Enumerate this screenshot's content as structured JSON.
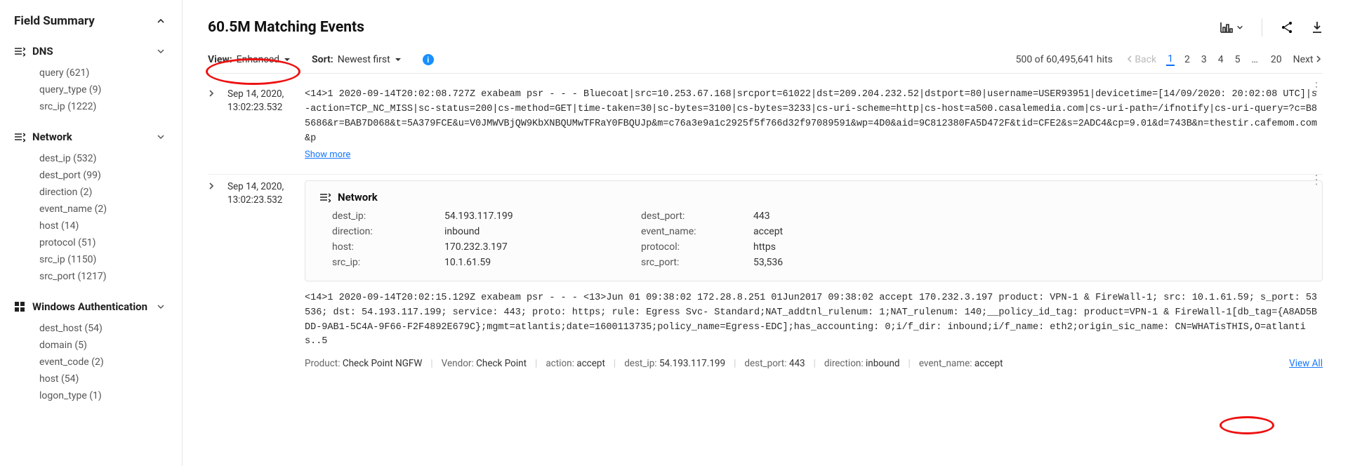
{
  "sidebar": {
    "title": "Field Summary",
    "groups": [
      {
        "icon": "dns",
        "label": "DNS",
        "items": [
          "query (621)",
          "query_type (9)",
          "src_ip (1222)"
        ]
      },
      {
        "icon": "network",
        "label": "Network",
        "items": [
          "dest_ip (532)",
          "dest_port (99)",
          "direction (2)",
          "event_name (2)",
          "host (14)",
          "protocol (51)",
          "src_ip (1150)",
          "src_port (1217)"
        ]
      },
      {
        "icon": "windows",
        "label": "Windows Authentication",
        "items": [
          "dest_host (54)",
          "domain (5)",
          "event_code (2)",
          "host (54)",
          "logon_type (1)"
        ]
      }
    ]
  },
  "header": {
    "title": "60.5M Matching Events"
  },
  "controls": {
    "view_label": "View:",
    "view_value": "Enhanced",
    "sort_label": "Sort:",
    "sort_value": "Newest first",
    "hits_text": "500 of 60,495,641 hits",
    "back_label": "Back",
    "next_label": "Next",
    "pages": [
      "1",
      "2",
      "3",
      "4",
      "5"
    ],
    "last_page": "20"
  },
  "events": [
    {
      "ts_line1": "Sep 14, 2020,",
      "ts_line2": "13:02:23.532",
      "raw": "<14>1 2020-09-14T20:02:08.727Z exabeam psr - - - Bluecoat|src=10.253.67.168|srcport=61022|dst=209.204.232.52|dstport=80|username=USER93951|devicetime=[14/09/2020: 20:02:08 UTC]|s-action=TCP_NC_MISS|sc-status=200|cs-method=GET|time-taken=30|sc-bytes=3100|cs-bytes=3233|cs-uri-scheme=http|cs-host=a500.casalemedia.com|cs-uri-path=/ifnotify|cs-uri-query=?c=B85686&r=BAB7D068&t=5A379FCE&u=V0JMWVBjQW9KbXNBQUMwTFRaY0FBQUJp&m=c76a3e9a1c2925f5f766d32f97089591&wp=4D0&aid=9C812380FA5D472F&tid=CFE2&s=2ADC4&cp=9.01&d=743B&n=thestir.cafemom.com&p",
      "show_more": "Show more"
    },
    {
      "ts_line1": "Sep 14, 2020,",
      "ts_line2": "13:02:23.532",
      "card": {
        "title": "Network",
        "pairs": [
          {
            "k": "dest_ip:",
            "v": "54.193.117.199"
          },
          {
            "k": "dest_port:",
            "v": "443"
          },
          {
            "k": "direction:",
            "v": "inbound"
          },
          {
            "k": "event_name:",
            "v": "accept"
          },
          {
            "k": "host:",
            "v": "170.232.3.197"
          },
          {
            "k": "protocol:",
            "v": "https"
          },
          {
            "k": "src_ip:",
            "v": "10.1.61.59"
          },
          {
            "k": "src_port:",
            "v": "53,536"
          }
        ]
      },
      "raw": "<14>1 2020-09-14T20:02:15.129Z exabeam psr - - - <13>Jun 01 09:38:02 172.28.8.251 01Jun2017 09:38:02 accept 170.232.3.197 product: VPN-1 & FireWall-1; src: 10.1.61.59; s_port: 53536; dst: 54.193.117.199; service: 443; proto: https; rule: Egress Svc- Standard;NAT_addtnl_rulenum: 1;NAT_rulenum: 140;__policy_id_tag: product=VPN-1 & FireWall-1[db_tag={A8AD5BDD-9AB1-5C4A-9F66-F2F4892E679C};mgmt=atlantis;date=1600113735;policy_name=Egress-EDC];has_accounting: 0;i/f_dir: inbound;i/f_name: eth2;origin_sic_name: CN=WHATisTHIS,O=atlantis..5",
      "meta": [
        {
          "k": "Product:",
          "v": "Check Point NGFW"
        },
        {
          "k": "Vendor:",
          "v": "Check Point"
        },
        {
          "k": "action:",
          "v": "accept"
        },
        {
          "k": "dest_ip:",
          "v": "54.193.117.199"
        },
        {
          "k": "dest_port:",
          "v": "443"
        },
        {
          "k": "direction:",
          "v": "inbound"
        },
        {
          "k": "event_name:",
          "v": "accept"
        }
      ],
      "view_all": "View All"
    }
  ]
}
